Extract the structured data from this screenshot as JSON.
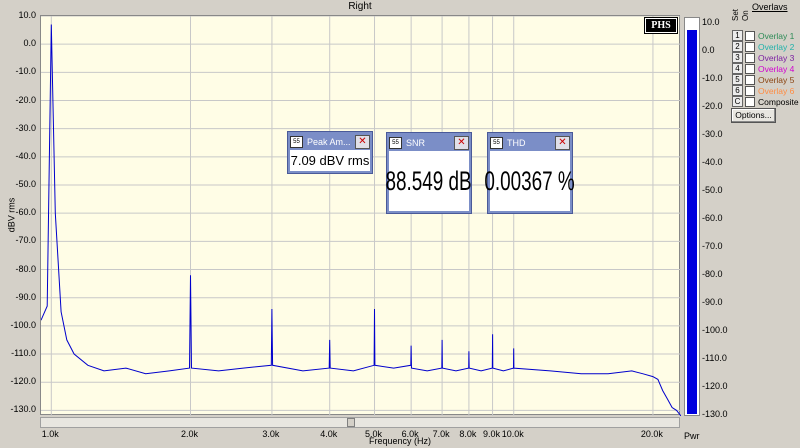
{
  "chart_title": "Right",
  "y_axis_label": "dBV rms",
  "x_axis_label": "Frequency (Hz)",
  "y_ticks": [
    "10.0",
    "0.0",
    "-10.0",
    "-20.0",
    "-30.0",
    "-40.0",
    "-50.0",
    "-60.0",
    "-70.0",
    "-80.0",
    "-90.0",
    "-100.0",
    "-110.0",
    "-120.0",
    "-130.0"
  ],
  "x_ticks": [
    "1.0k",
    "2.0k",
    "3.0k",
    "4.0k",
    "5.0k",
    "6.0k",
    "7.0k",
    "8.0k",
    "9.0k",
    "10.0k",
    "20.0k"
  ],
  "logo": "PHS",
  "power_meter": {
    "label": "Pwr",
    "ticks": [
      "10.0",
      "0.0",
      "-10.0",
      "-20.0",
      "-30.0",
      "-40.0",
      "-50.0",
      "-60.0",
      "-70.0",
      "-80.0",
      "-90.0",
      "-100.0",
      "-110.0",
      "-120.0",
      "-130.0"
    ],
    "level_dbv": 7.09,
    "fill_color": "#0000dd"
  },
  "overlays": {
    "title": "Overlavs",
    "col_set": "Set",
    "col_on": "On",
    "items": [
      {
        "key": "1",
        "label": "Overlay 1",
        "color": "#2e8b57"
      },
      {
        "key": "2",
        "label": "Overlay 2",
        "color": "#20b2aa"
      },
      {
        "key": "3",
        "label": "Overlay 3",
        "color": "#7b1fa2"
      },
      {
        "key": "4",
        "label": "Overlay 4",
        "color": "#d000d0"
      },
      {
        "key": "5",
        "label": "Overlay 5",
        "color": "#8b4513"
      },
      {
        "key": "6",
        "label": "Overlay 6",
        "color": "#ff8c42"
      },
      {
        "key": "C",
        "label": "Composite",
        "color": "#000000"
      }
    ],
    "options_label": "Options..."
  },
  "meters": [
    {
      "id": "peak",
      "title": "Peak Am...",
      "value": "7.09 dBV rms"
    },
    {
      "id": "snr",
      "title": "SNR",
      "value": "88.549 dB"
    },
    {
      "id": "thd",
      "title": "THD",
      "value": "0.00367 %"
    }
  ],
  "colors": {
    "trace": "#0000cc",
    "plot_background": "#fffde6",
    "grid": "#c8c8c8",
    "meter_frame": "#7b8ec7"
  },
  "chart_data": {
    "type": "line",
    "title": "Right",
    "xlabel": "Frequency (Hz)",
    "ylabel": "dBV rms",
    "x_scale": "log",
    "xlim": [
      950,
      23000
    ],
    "ylim": [
      -132,
      10
    ],
    "grid": true,
    "series": [
      {
        "values": [
          [
            950,
            -98
          ],
          [
            980,
            -93
          ],
          [
            1000,
            7
          ],
          [
            1020,
            -60
          ],
          [
            1050,
            -95
          ],
          [
            1080,
            -105
          ],
          [
            1120,
            -110
          ],
          [
            1200,
            -114
          ],
          [
            1300,
            -116
          ],
          [
            1450,
            -115
          ],
          [
            1600,
            -117
          ],
          [
            1800,
            -116
          ],
          [
            1990,
            -115
          ],
          [
            2000,
            -82
          ],
          [
            2010,
            -115
          ],
          [
            2300,
            -116
          ],
          [
            2600,
            -115
          ],
          [
            2990,
            -114
          ],
          [
            3000,
            -94
          ],
          [
            3010,
            -114
          ],
          [
            3500,
            -116
          ],
          [
            3990,
            -115
          ],
          [
            4000,
            -105
          ],
          [
            4010,
            -115
          ],
          [
            4500,
            -116
          ],
          [
            4990,
            -114
          ],
          [
            5000,
            -94
          ],
          [
            5010,
            -114
          ],
          [
            5500,
            -115
          ],
          [
            5990,
            -114
          ],
          [
            6000,
            -107
          ],
          [
            6010,
            -115
          ],
          [
            6500,
            -116
          ],
          [
            6990,
            -115
          ],
          [
            7000,
            -105
          ],
          [
            7010,
            -115
          ],
          [
            7500,
            -116
          ],
          [
            7990,
            -115
          ],
          [
            8000,
            -109
          ],
          [
            8010,
            -115
          ],
          [
            8500,
            -116
          ],
          [
            8990,
            -115
          ],
          [
            9000,
            -103
          ],
          [
            9010,
            -115
          ],
          [
            9500,
            -116
          ],
          [
            9990,
            -115
          ],
          [
            10000,
            -108
          ],
          [
            10010,
            -115
          ],
          [
            12000,
            -116
          ],
          [
            14000,
            -117
          ],
          [
            16000,
            -117
          ],
          [
            18000,
            -116
          ],
          [
            19000,
            -117
          ],
          [
            20000,
            -118
          ],
          [
            20500,
            -119
          ],
          [
            21000,
            -123
          ],
          [
            21500,
            -126
          ],
          [
            22000,
            -129
          ],
          [
            22500,
            -130
          ],
          [
            23000,
            -132
          ]
        ]
      }
    ]
  }
}
